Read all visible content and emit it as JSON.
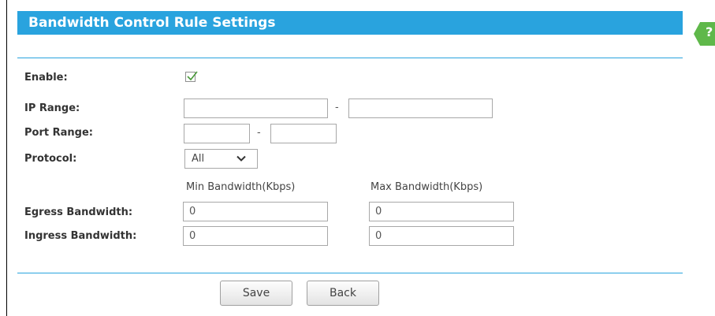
{
  "header": {
    "title": "Bandwidth Control Rule Settings",
    "help_glyph": "?"
  },
  "form": {
    "enable": {
      "label": "Enable:",
      "checked": true
    },
    "ip_range": {
      "label": "IP Range:",
      "start_value": "",
      "separator": "-",
      "end_value": ""
    },
    "port_range": {
      "label": "Port Range:",
      "start_value": "",
      "separator": "-",
      "end_value": ""
    },
    "protocol": {
      "label": "Protocol:",
      "selected": "All"
    },
    "bandwidth_headers": {
      "min": "Min Bandwidth(Kbps)",
      "max": "Max Bandwidth(Kbps)"
    },
    "egress": {
      "label": "Egress Bandwidth:",
      "min_value": "0",
      "max_value": "0"
    },
    "ingress": {
      "label": "Ingress Bandwidth:",
      "min_value": "0",
      "max_value": "0"
    }
  },
  "buttons": {
    "save_label": "Save",
    "back_label": "Back"
  },
  "colors": {
    "accent": "#29a3de",
    "help_tab": "#5fb84a",
    "checkmark": "#4a9a3a"
  },
  "icons": {
    "help": "help-icon",
    "check": "checkmark-icon",
    "dropdown": "chevron-down-icon"
  }
}
